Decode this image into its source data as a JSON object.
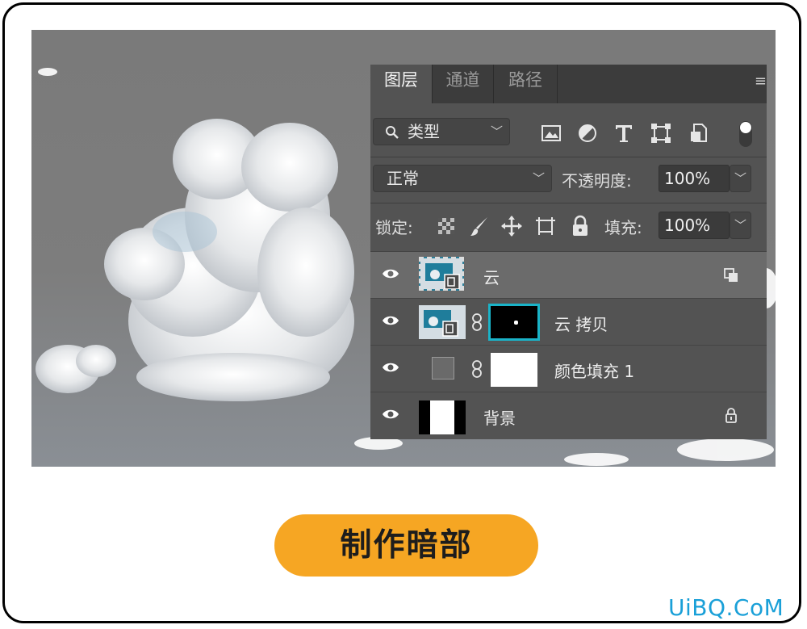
{
  "panel": {
    "tabs": [
      {
        "label": "图层",
        "active": true
      },
      {
        "label": "通道",
        "active": false
      },
      {
        "label": "路径",
        "active": false
      }
    ],
    "filter": {
      "label": "类型",
      "icon": "search-icon"
    },
    "filter_icons": [
      "image-filter-icon",
      "adjustment-filter-icon",
      "type-filter-icon",
      "shape-filter-icon",
      "smart-object-filter-icon",
      "filter-toggle-icon"
    ],
    "blend_mode": "正常",
    "opacity_label": "不透明度:",
    "opacity_value": "100%",
    "lock_label": "锁定:",
    "lock_icons": [
      "lock-transparent-pixels-icon",
      "lock-image-pixels-icon",
      "lock-position-icon",
      "lock-artboard-icon",
      "lock-all-icon"
    ],
    "fill_label": "填充:",
    "fill_value": "100%",
    "layers": [
      {
        "name": "云",
        "selected": true,
        "type": "smart-object"
      },
      {
        "name": "云 拷贝",
        "selected": false,
        "type": "smart-object-with-mask"
      },
      {
        "name": "颜色填充 1",
        "selected": false,
        "type": "fill-layer"
      },
      {
        "name": "背景",
        "selected": false,
        "type": "background",
        "locked": true
      }
    ]
  },
  "button": {
    "label": "制作暗部"
  },
  "watermark": "UiBQ.CoM",
  "colors": {
    "accent": "#f6a623",
    "panel_bg": "#535353",
    "selection": "#6b6b6b",
    "mask_outline": "#1ab3c8",
    "watermark": "#1aa0d8"
  }
}
